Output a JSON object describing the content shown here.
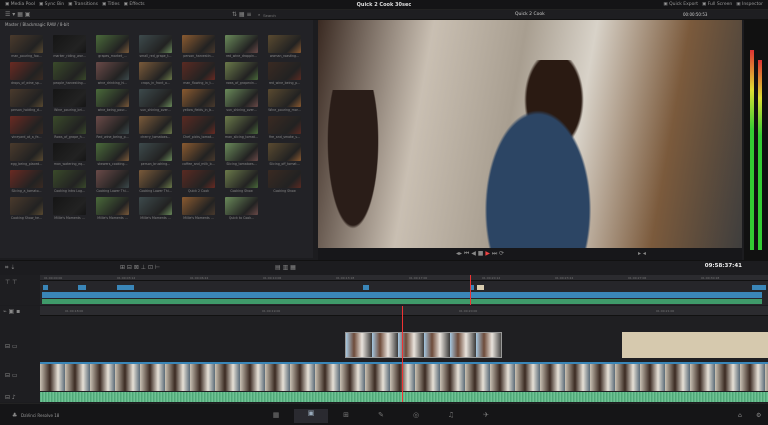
{
  "topbar": {
    "menus": [
      {
        "icon": "media-pool-icon",
        "label": "Media Pool"
      },
      {
        "icon": "sync-bin-icon",
        "label": "Sync Bin"
      },
      {
        "icon": "transitions-icon",
        "label": "Transitions"
      },
      {
        "icon": "titles-icon",
        "label": "Titles"
      },
      {
        "icon": "effects-icon",
        "label": "Effects"
      }
    ],
    "project_title": "Quick 2 Cook 30sec",
    "right": [
      {
        "icon": "quick-export-icon",
        "label": "Quick Export"
      },
      {
        "icon": "full-screen-icon",
        "label": "Full Screen"
      },
      {
        "icon": "inspector-icon",
        "label": "Inspector"
      }
    ]
  },
  "toolbar": {
    "search_placeholder": "Search",
    "timeline_name": "Quick 2 Cook",
    "viewer_timecode": "00:00:50:53"
  },
  "media_pool": {
    "breadcrumb": "Master / Blackmagic RAW / 8-bit",
    "clips": [
      "man_pouring_foo...",
      "marker_riding_wor...",
      "grapes_market_...",
      "small_red_grape_t...",
      "person_harvestin...",
      "red_wine_droppin...",
      "woman_roasting...",
      "drops_of_wine_sp...",
      "people_harvesting...",
      "wine_drinking_hi...",
      "crops_in_front_o...",
      "man_flowing_in_t...",
      "rows_of_grapevin...",
      "red_wine_being_p...",
      "person_holding_d...",
      "Wine_pouring_bri...",
      "wine_being_pour...",
      "sun_shining_over...",
      "yellow_fields_in_b...",
      "sun_shining_over...",
      "Wine_pouring_mor...",
      "vineyard_at_a_fe...",
      "Rows_of_grape_h...",
      "Red_wine_being_p...",
      "cherry_tomatoes...",
      "Chef_picks_tomat...",
      "man_slicing_tomat...",
      "fire_and_smoke_s...",
      "egg_being_placed...",
      "man_watering_eq...",
      "skewers_cooking...",
      "person_brushing...",
      "coffee_and_milk_b...",
      "Slicing_tomatoes...",
      "Slicing_off_tomat...",
      "Slicing_a_tomato...",
      "Cooking Intro Log...",
      "Cooking Lower Thi...",
      "Cooking Lower Thi...",
      "Quick 2 Cook",
      "Cooking Show",
      "Cooking Show",
      "Cooking Show_he...",
      "Millie's Moments ...",
      "Millie's Moments ...",
      "Millie's Moments ...",
      "Millie's Moments ...",
      "Quick to Cook..."
    ]
  },
  "transport": {
    "timecode": "09:58:37:41"
  },
  "upper_ruler": [
    "01:00:00:00",
    "01:00:03:12",
    "01:00:06:24",
    "01:00:10:06",
    "01:00:13:18",
    "01:00:17:00",
    "01:00:20:12",
    "01:00:23:24",
    "01:00:27:06",
    "01:00:30:18"
  ],
  "lower_ruler": [
    "01:00:18:00",
    "01:00:19:00",
    "01:00:20:00",
    "01:00:21:00"
  ],
  "bottom": {
    "app_name": "DaVinci Resolve 18",
    "pages": [
      "media-page-icon",
      "cut-page-icon",
      "edit-page-icon",
      "fusion-page-icon",
      "color-page-icon",
      "fairlight-page-icon",
      "deliver-page-icon"
    ],
    "active_page": "cut"
  },
  "colors": {
    "video": "#3a86b8",
    "audio": "#3f9a6a",
    "playhead": "#e33333",
    "accent": "#e04a3a"
  }
}
